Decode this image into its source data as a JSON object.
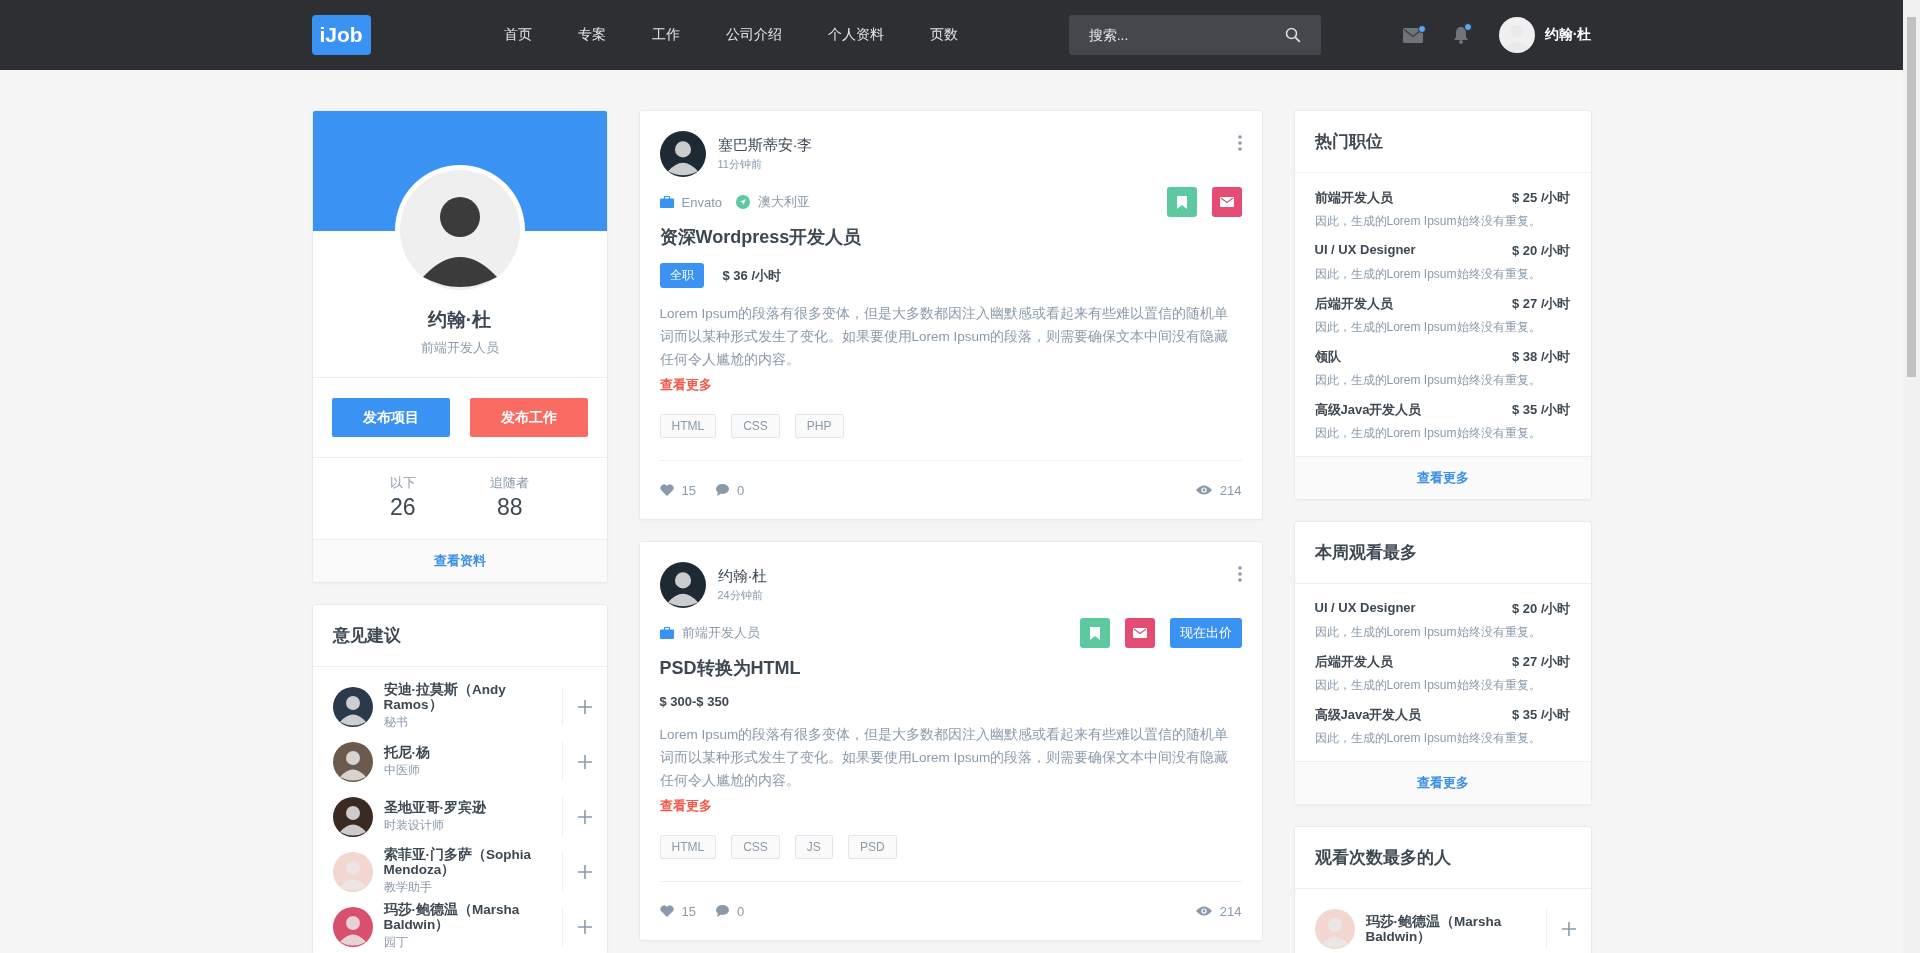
{
  "nav": {
    "logo": "iJob",
    "links": [
      "首页",
      "专案",
      "工作",
      "公司介绍",
      "个人资料",
      "页数"
    ],
    "search": {
      "placeholder": "搜索..."
    },
    "notifications": [
      {
        "kind": "mail",
        "unread": true
      },
      {
        "kind": "bell",
        "unread": true
      }
    ],
    "user": {
      "name": "约翰·杜"
    }
  },
  "profile": {
    "name": "约翰·杜",
    "role": "前端开发人员",
    "buttons": [
      {
        "label": "发布项目",
        "kind": "primary"
      },
      {
        "label": "发布工作",
        "kind": "danger"
      }
    ],
    "stats": [
      {
        "label": "以下",
        "value": "26"
      },
      {
        "label": "追随者",
        "value": "88"
      }
    ],
    "link": "查看资料"
  },
  "suggestions": {
    "title": "意见建议",
    "people": [
      {
        "name": "安迪·拉莫斯（Andy Ramos）",
        "role": "秘书"
      },
      {
        "name": "托尼·杨",
        "role": "中医师"
      },
      {
        "name": "圣地亚哥·罗宾逊",
        "role": "时装设计师"
      },
      {
        "name": "索菲亚·门多萨（Sophia Mendoza）",
        "role": "教学助手"
      },
      {
        "name": "玛莎·鲍德温（Marsha Baldwin）",
        "role": "园丁"
      }
    ]
  },
  "posts": [
    {
      "author": "塞巴斯蒂安·李",
      "time": "11分钟前",
      "meta": [
        {
          "kind": "company",
          "text": "Envato"
        },
        {
          "kind": "location",
          "text": "澳大利亚"
        }
      ],
      "title": "资深Wordpress开发人员",
      "badge": "全职",
      "price": "$ 36 /小时",
      "body": "Lorem Ipsum的段落有很多变体，但是大多数都因注入幽默感或看起来有些难以置信的随机单词而以某种形式发生了变化。如果要使用Lorem Ipsum的段落，则需要确保文本中间没有隐藏任何令人尴尬的内容。",
      "more": "查看更多",
      "tags": [
        "HTML",
        "CSS",
        "PHP"
      ],
      "likes": "15",
      "comments": "0",
      "views": "214"
    },
    {
      "author": "约翰·杜",
      "time": "24分钟前",
      "meta": [
        {
          "kind": "company",
          "text": "前端开发人员"
        }
      ],
      "bid": "现在出价",
      "title": "PSD转换为HTML",
      "price": "$ 300-$ 350",
      "body": "Lorem Ipsum的段落有很多变体，但是大多数都因注入幽默感或看起来有些难以置信的随机单词而以某种形式发生了变化。如果要使用Lorem Ipsum的段落，则需要确保文本中间没有隐藏任何令人尴尬的内容。",
      "more": "查看更多",
      "tags": [
        "HTML",
        "CSS",
        "JS",
        "PSD"
      ],
      "likes": "15",
      "comments": "0",
      "views": "214"
    }
  ],
  "hot_jobs": {
    "title": "热门职位",
    "items": [
      {
        "title": "前端开发人员",
        "price": "$ 25 /小时",
        "desc": "因此，生成的Lorem Ipsum始终没有重复。"
      },
      {
        "title": "UI / UX Designer",
        "price": "$ 20 /小时",
        "desc": "因此，生成的Lorem Ipsum始终没有重复。"
      },
      {
        "title": "后端开发人员",
        "price": "$ 27 /小时",
        "desc": "因此，生成的Lorem Ipsum始终没有重复。"
      },
      {
        "title": "领队",
        "price": "$ 38 /小时",
        "desc": "因此，生成的Lorem Ipsum始终没有重复。"
      },
      {
        "title": "高级Java开发人员",
        "price": "$ 35 /小时",
        "desc": "因此，生成的Lorem Ipsum始终没有重复。"
      }
    ],
    "more": "查看更多"
  },
  "weekly": {
    "title": "本周观看最多",
    "items": [
      {
        "title": "UI / UX Designer",
        "price": "$ 20 /小时",
        "desc": "因此，生成的Lorem Ipsum始终没有重复。"
      },
      {
        "title": "后端开发人员",
        "price": "$ 27 /小时",
        "desc": "因此，生成的Lorem Ipsum始终没有重复。"
      },
      {
        "title": "高级Java开发人员",
        "price": "$ 35 /小时",
        "desc": "因此，生成的Lorem Ipsum始终没有重复。"
      }
    ],
    "more": "查看更多"
  },
  "most_viewed": {
    "title": "观看次数最多的人",
    "people": [
      {
        "name": "玛莎·鲍德温（Marsha Baldwin）"
      }
    ]
  }
}
